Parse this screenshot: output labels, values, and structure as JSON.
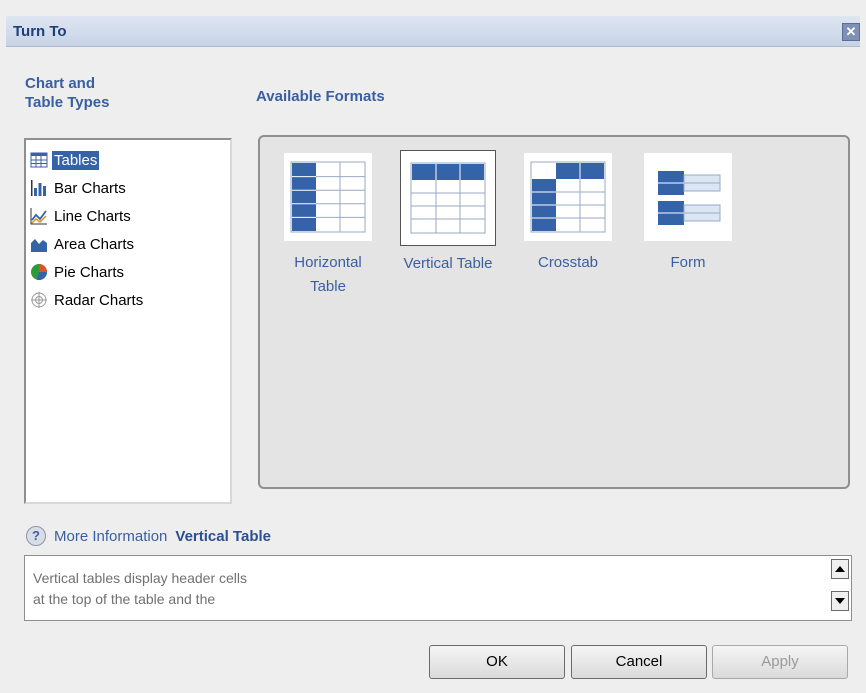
{
  "dialog": {
    "title": "Turn To"
  },
  "types": {
    "heading": "Chart and\nTable Types",
    "items": [
      {
        "label": "Tables",
        "icon": "tables-icon",
        "selected": true
      },
      {
        "label": "Bar Charts",
        "icon": "bar-chart-icon"
      },
      {
        "label": "Line Charts",
        "icon": "line-chart-icon"
      },
      {
        "label": "Area Charts",
        "icon": "area-chart-icon"
      },
      {
        "label": "Pie Charts",
        "icon": "pie-chart-icon"
      },
      {
        "label": "Radar Charts",
        "icon": "radar-chart-icon"
      }
    ]
  },
  "formats": {
    "heading": "Available Formats",
    "items": [
      {
        "label": "Horizontal\nTable",
        "icon": "horizontal-table-icon"
      },
      {
        "label": "Vertical Table",
        "icon": "vertical-table-icon",
        "selected": true
      },
      {
        "label": "Crosstab",
        "icon": "crosstab-icon"
      },
      {
        "label": "Form",
        "icon": "form-icon"
      }
    ]
  },
  "info": {
    "help_icon": "?",
    "more_information": "More Information",
    "title": "Vertical Table",
    "description_line1": "Vertical tables display header cells",
    "description_line2": "at the top of the table and the"
  },
  "buttons": {
    "ok": "OK",
    "cancel": "Cancel",
    "apply": "Apply",
    "apply_disabled": true
  },
  "colors": {
    "accent": "#3563a8",
    "label_blue": "#3a5fa0",
    "title_blue": "#1f3f7a"
  }
}
